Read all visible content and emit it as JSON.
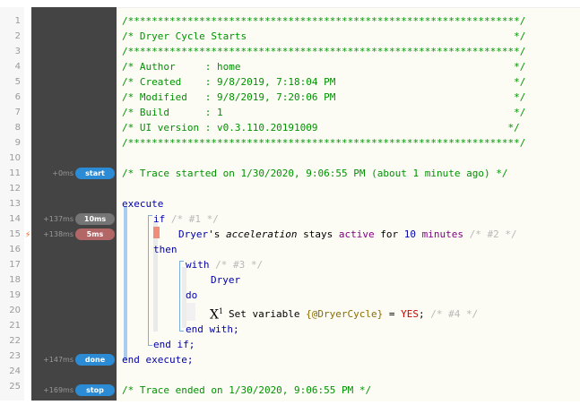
{
  "header_comment": {
    "stars_line": "/******************************************************************/",
    "title_line": "/* Dryer Cycle Starts                                             */",
    "author_line": "/* Author     : home                                              */",
    "created_line": "/* Created    : 9/8/2019, 7:18:04 PM                              */",
    "modified_line": "/* Modified   : 9/8/2019, 7:20:06 PM                              */",
    "build_line": "/* Build      : 1                                                 */",
    "ui_version_line": "/* UI version : v0.3.110.20191009                                */"
  },
  "line_numbers": [
    "1",
    "2",
    "3",
    "4",
    "5",
    "6",
    "7",
    "8",
    "9",
    "10",
    "11",
    "12",
    "13",
    "14",
    "15",
    "16",
    "17",
    "18",
    "19",
    "20",
    "21",
    "22",
    "23",
    "24",
    "25"
  ],
  "trace": {
    "start": {
      "time": "+0ms",
      "badge": "start"
    },
    "if": {
      "time": "+137ms",
      "badge": "10ms"
    },
    "condition": {
      "time": "+138ms",
      "badge": "5ms"
    },
    "done": {
      "time": "+147ms",
      "badge": "done"
    },
    "stop": {
      "time": "+169ms",
      "badge": "stop"
    },
    "started_comment": "/* Trace started on 1/30/2020, 9:06:55 PM (about 1 minute ago) */",
    "ended_comment": "/* Trace ended on 1/30/2020, 9:06:55 PM */"
  },
  "code": {
    "execute": "execute",
    "if_kw": "if",
    "if_tag": "/* #1 */",
    "device": "Dryer",
    "possessive": "'s",
    "attribute": "acceleration",
    "stays": "stays",
    "state": "active",
    "for_kw": "for",
    "duration_value": "10",
    "duration_unit": "minutes",
    "cond_tag": "/* #2 */",
    "then_kw": "then",
    "with_kw": "with",
    "with_tag": "/* #3 */",
    "with_device": "Dryer",
    "do_kw": "do",
    "action_icon": "X",
    "action_icon_sup": "1",
    "action_text": "Set variable",
    "variable": "{@DryerCycle}",
    "equals": "=",
    "value": "YES",
    "semicolon": ";",
    "action_tag": "/* #4 */",
    "end_with": "end with;",
    "end_if": "end if;",
    "end_execute": "end execute;"
  },
  "icons": {
    "bolt": "lightning-bolt-icon",
    "variable_action": "variable-x-icon"
  },
  "colors": {
    "comment": "#009200",
    "keyword": "#0000aa",
    "tag": "#b8b8b8",
    "state": "#800080",
    "value": "#cc0000",
    "badge_blue": "#2b8bd4",
    "badge_grey": "#757575",
    "badge_red": "#b36666"
  }
}
